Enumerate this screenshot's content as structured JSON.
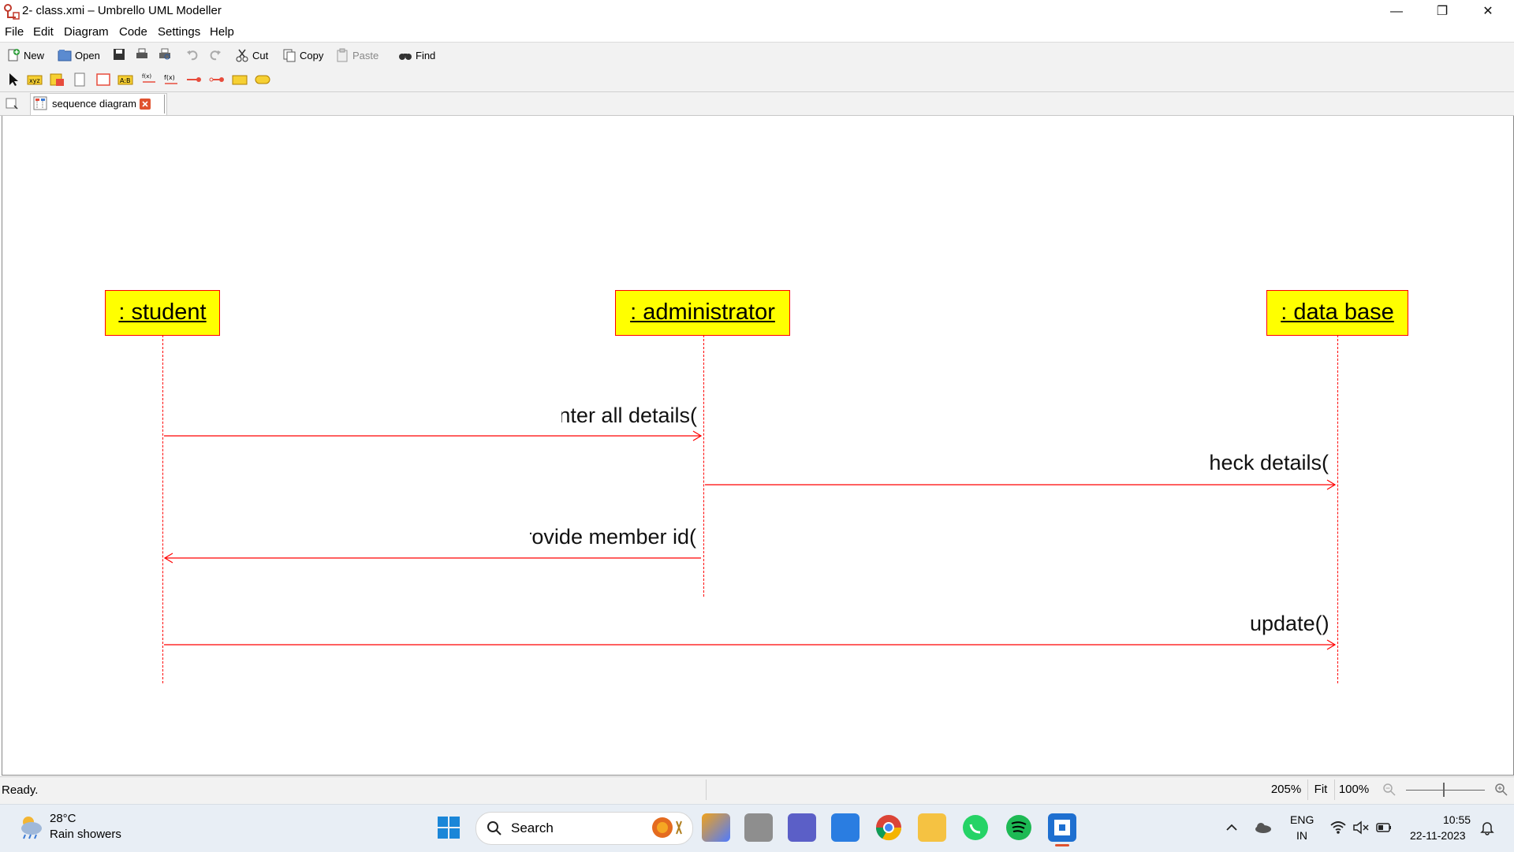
{
  "window": {
    "title": "2- class.xmi – Umbrello UML Modeller",
    "minimize_glyph": "—",
    "restore_glyph": "❐",
    "close_glyph": "✕"
  },
  "menu": {
    "items": [
      {
        "label": "File"
      },
      {
        "label": "Edit"
      },
      {
        "label": "Diagram"
      },
      {
        "label": "Code"
      },
      {
        "label": "Settings"
      },
      {
        "label": "Help"
      }
    ]
  },
  "toolbar": {
    "new": "New",
    "open": "Open",
    "cut": "Cut",
    "copy": "Copy",
    "paste": "Paste",
    "find": "Find"
  },
  "tabs": {
    "active": "sequence diagram"
  },
  "diagram": {
    "objects": [
      {
        "name": " : student"
      },
      {
        "name": " : administrator"
      },
      {
        "name": " : data base"
      }
    ],
    "messages": [
      {
        "label": "nter all details("
      },
      {
        "label": "heck details("
      },
      {
        "label": "rovide member id("
      },
      {
        "label": "update()"
      }
    ]
  },
  "status": {
    "text": "Ready.",
    "zoom": "205%",
    "fit": "Fit",
    "hundred": "100%"
  },
  "taskbar": {
    "weather_temp": "28°C",
    "weather_desc": "Rain showers",
    "search": "Search",
    "lang1": "ENG",
    "lang2": "IN",
    "time": "10:55",
    "date": "22-11-2023"
  },
  "colors": {
    "object_fill": "#ffff00",
    "uml_stroke": "#ff0000"
  }
}
